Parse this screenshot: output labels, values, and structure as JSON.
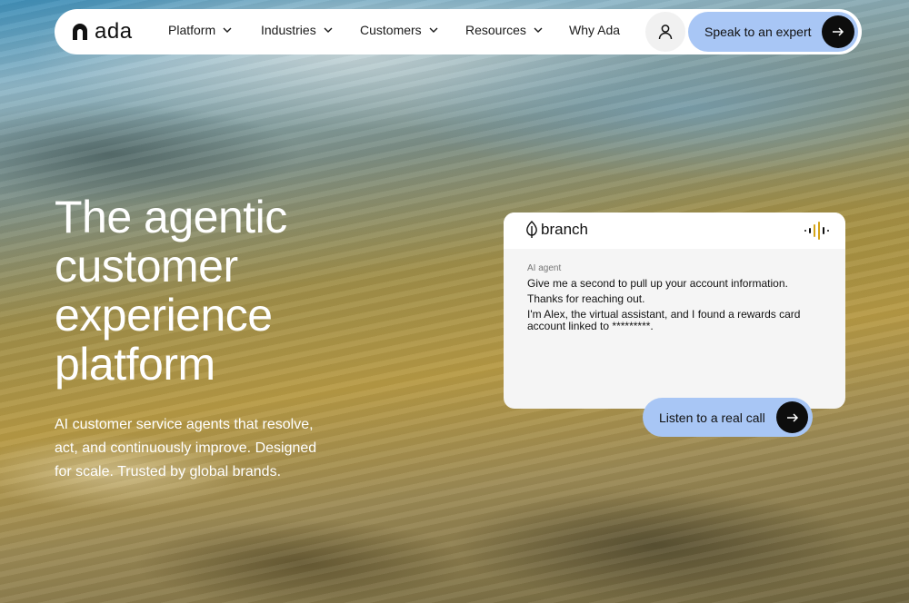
{
  "brand": {
    "name": "ada"
  },
  "nav": {
    "items": [
      {
        "label": "Platform",
        "dropdown": true
      },
      {
        "label": "Industries",
        "dropdown": true
      },
      {
        "label": "Customers",
        "dropdown": true
      },
      {
        "label": "Resources",
        "dropdown": true
      },
      {
        "label": "Why Ada",
        "dropdown": false
      }
    ],
    "account_icon": "user-icon",
    "cta_label": "Speak to an expert"
  },
  "hero": {
    "title": "The agentic customer experience platform",
    "subtitle": "AI customer service agents that resolve, act, and continuously improve. Designed for scale. Trusted by global brands."
  },
  "demo_card": {
    "brand": "branch",
    "speaker_label": "AI agent",
    "messages": [
      "Give me a second to pull up your account information.",
      "Thanks for reaching out.",
      "I'm Alex, the virtual assistant, and I found a rewards card account linked to *********."
    ],
    "listen_label": "Listen to a real call"
  },
  "colors": {
    "accent": "#a8c6f5",
    "button_dark": "#0d0d0d",
    "nav_bg": "#ffffff",
    "text_on_hero": "#ffffff"
  }
}
